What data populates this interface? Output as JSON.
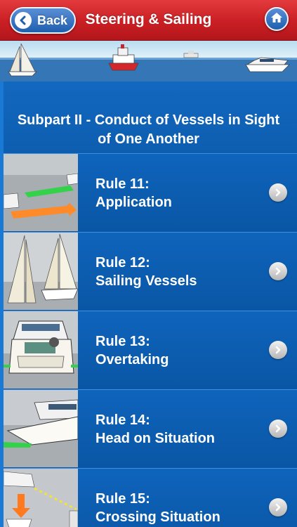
{
  "header": {
    "back_label": "Back",
    "title": "Steering & Sailing"
  },
  "subpart_title": "Subpart II - Conduct of Vessels in Sight of One Another",
  "rules": [
    {
      "number": "Rule 11:",
      "name": "Application"
    },
    {
      "number": "Rule 12:",
      "name": "Sailing Vessels"
    },
    {
      "number": "Rule 13:",
      "name": "Overtaking"
    },
    {
      "number": "Rule 14:",
      "name": "Head on Situation"
    },
    {
      "number": "Rule 15:",
      "name": "Crossing Situation"
    }
  ],
  "icons": {
    "back": "chevron-left-icon",
    "home": "home-icon",
    "row": "chevron-right-icon"
  },
  "colors": {
    "header_red": "#c91f24",
    "content_blue": "#0a56a5",
    "button_blue": "#1e5fae"
  }
}
